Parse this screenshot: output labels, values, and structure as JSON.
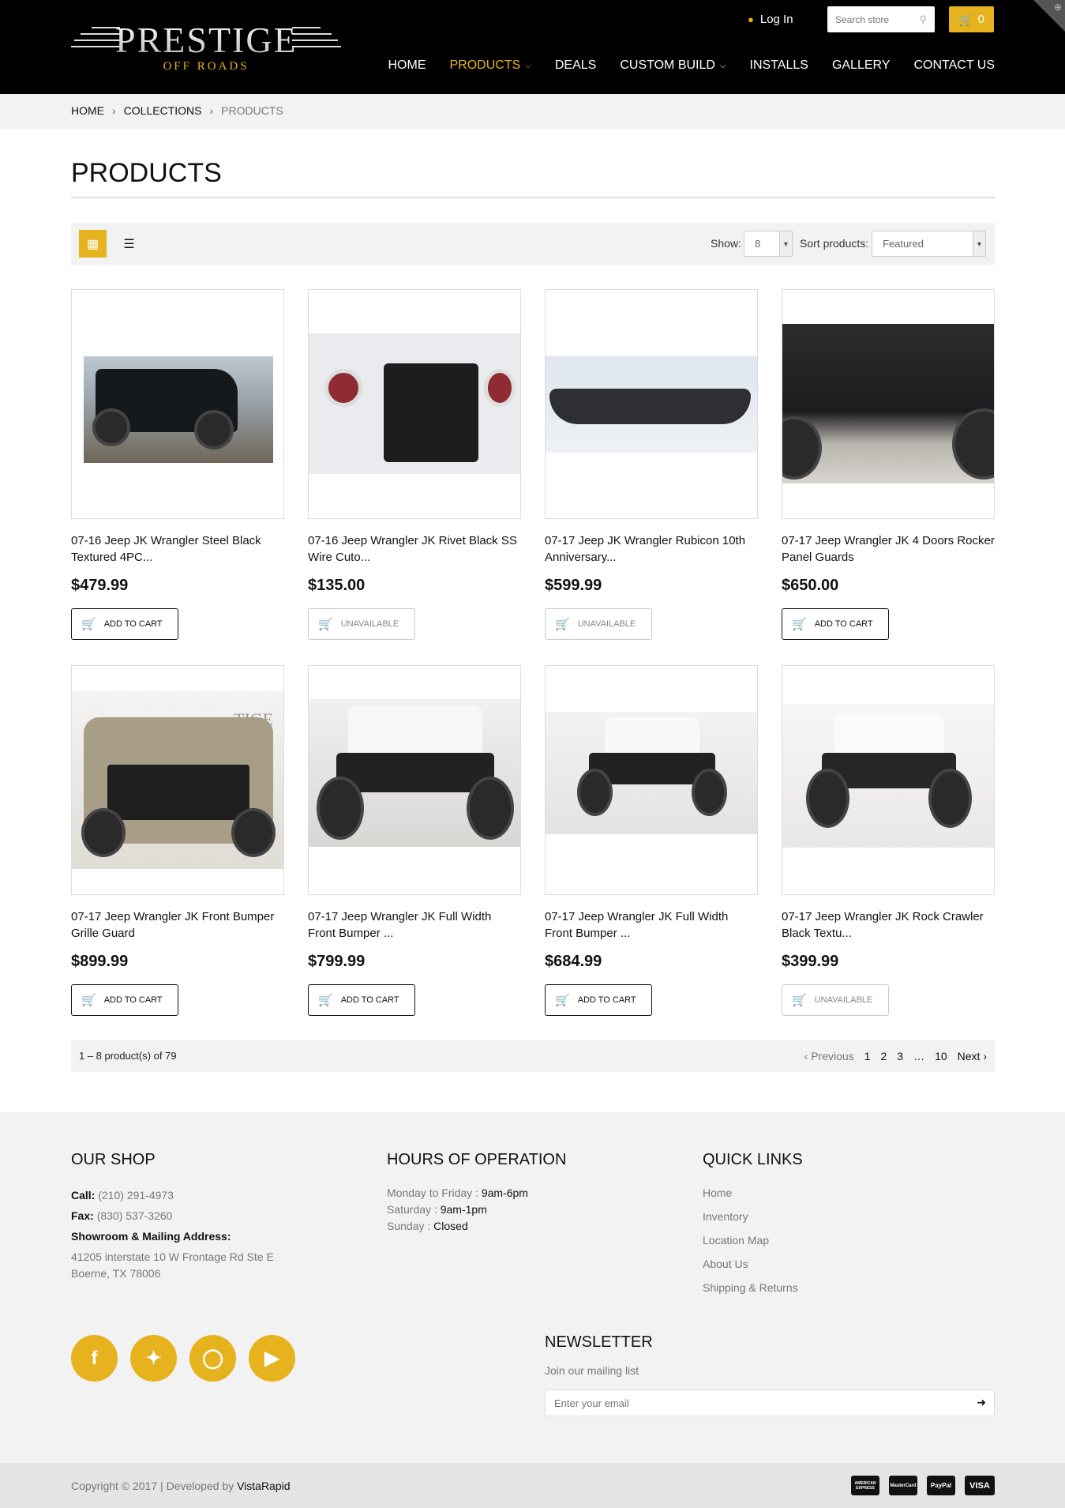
{
  "header": {
    "logo_brand": "PRESTIGE",
    "logo_sub": "OFF ROADS",
    "login_label": "Log In",
    "search_placeholder": "Search store",
    "cart_count": "0",
    "nav": [
      {
        "label": "HOME"
      },
      {
        "label": "PRODUCTS"
      },
      {
        "label": "DEALS"
      },
      {
        "label": "CUSTOM BUILD"
      },
      {
        "label": "INSTALLS"
      },
      {
        "label": "GALLERY"
      },
      {
        "label": "CONTACT US"
      }
    ],
    "accent": "#e6b31e"
  },
  "breadcrumb": {
    "home": "HOME",
    "collections": "COLLECTIONS",
    "current": "PRODUCTS"
  },
  "page_title": "PRODUCTS",
  "toolbar": {
    "show_label": "Show:",
    "show_value": "8",
    "sort_label": "Sort products:",
    "sort_value": "Featured"
  },
  "products": [
    {
      "name": "07-16 Jeep JK Wrangler Steel Black Textured 4PC...",
      "price": "$479.99",
      "button": "ADD TO CART"
    },
    {
      "name": "07-16 Jeep Wrangler JK Rivet Black SS Wire Cuto...",
      "price": "$135.00",
      "button": "UNAVAILABLE"
    },
    {
      "name": "07-17 Jeep JK Wrangler Rubicon 10th Anniversary...",
      "price": "$599.99",
      "button": "UNAVAILABLE"
    },
    {
      "name": "07-17 Jeep Wrangler JK 4 Doors Rocker Panel Guards",
      "price": "$650.00",
      "button": "ADD TO CART"
    },
    {
      "name": "07-17 Jeep Wrangler JK Front Bumper Grille Guard",
      "price": "$899.99",
      "button": "ADD TO CART"
    },
    {
      "name": "07-17 Jeep Wrangler JK Full Width Front Bumper ...",
      "price": "$799.99",
      "button": "ADD TO CART"
    },
    {
      "name": "07-17 Jeep Wrangler JK Full Width Front Bumper ...",
      "price": "$684.99",
      "button": "ADD TO CART"
    },
    {
      "name": "07-17 Jeep Wrangler JK Rock Crawler Black Textu...",
      "price": "$399.99",
      "button": "UNAVAILABLE"
    }
  ],
  "product_image_text": "TIGE",
  "pagination": {
    "count": "1 – 8 product(s) of 79",
    "prev": "‹ Previous",
    "pages": [
      "1",
      "2",
      "3",
      "…",
      "10"
    ],
    "next": "Next ›"
  },
  "footer": {
    "shop_title": "OUR SHOP",
    "call_label": "Call:",
    "call_value": "(210) 291-4973",
    "fax_label": "Fax:",
    "fax_value": "(830) 537-3260",
    "address_label": "Showroom & Mailing Address:",
    "address_line1": "41205 interstate 10 W Frontage Rd Ste E",
    "address_line2": "Boerne, TX 78006",
    "hours_title": "HOURS OF OPERATION",
    "hours": [
      {
        "day": "Monday to Friday :",
        "time": "9am-6pm"
      },
      {
        "day": "Saturday :",
        "time": "9am-1pm"
      },
      {
        "day": "Sunday :",
        "time": "Closed"
      }
    ],
    "links_title": "QUICK LINKS",
    "links": [
      "Home",
      "Inventory",
      "Location Map",
      "About Us",
      "Shipping & Returns"
    ],
    "newsletter_title": "NEWSLETTER",
    "newsletter_sub": "Join our mailing list",
    "newsletter_placeholder": "Enter your email",
    "social": [
      "facebook-icon",
      "twitter-icon",
      "instagram-icon",
      "youtube-icon"
    ]
  },
  "bottom": {
    "copy": "Copyright © 2017 | Developed by",
    "developer": "VistaRapid",
    "payments": [
      "AMERICAN EXPRESS",
      "MasterCard",
      "PayPal",
      "VISA"
    ]
  }
}
